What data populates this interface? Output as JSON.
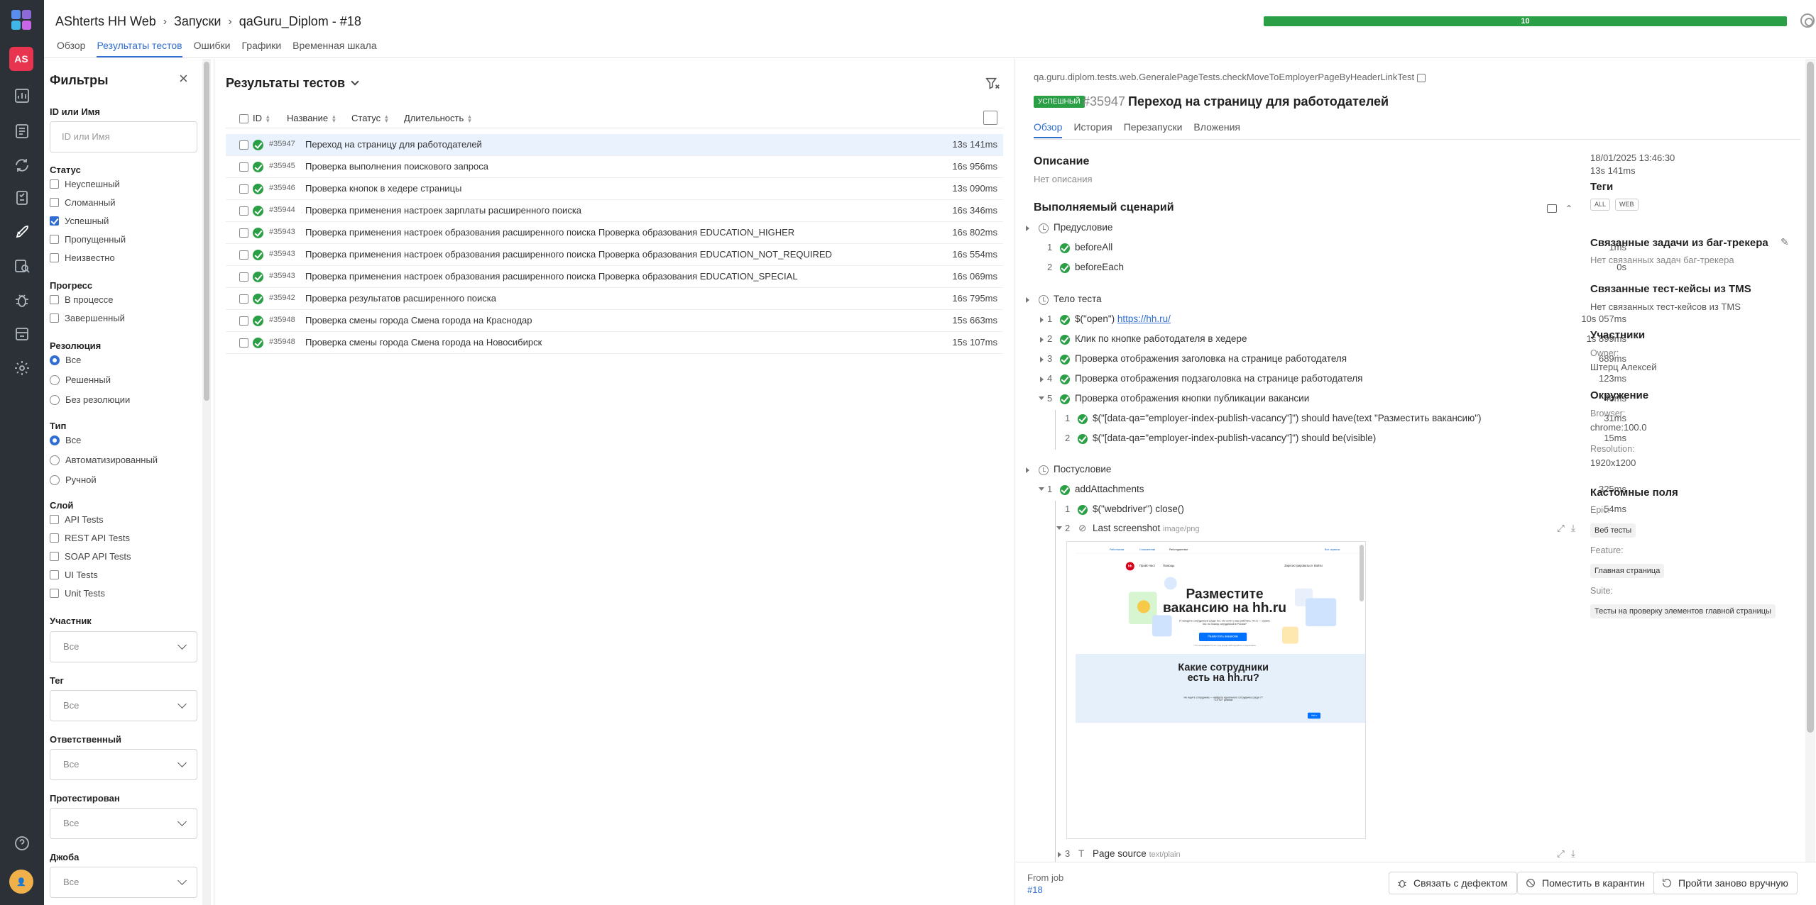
{
  "header": {
    "breadcrumb": [
      "AShterts HH Web",
      "Запуски",
      "qaGuru_Diplom - #18"
    ],
    "progress_label": "10",
    "progress_color": "#2b9f46",
    "accent_color": "#2f6dd0",
    "tabs": [
      "Обзор",
      "Результаты тестов",
      "Ошибки",
      "Графики",
      "Временная шкала"
    ],
    "active_tab": "Результаты тестов"
  },
  "rail": {
    "avatar": "AS",
    "user_avatar": "👤",
    "icons": [
      "allure-logo-icon",
      "dashboard-icon",
      "testcases-icon",
      "launches-icon",
      "jobs-icon",
      "rocket-icon",
      "search-results-icon",
      "bug-icon",
      "storage-icon",
      "settings-icon",
      "help-icon"
    ]
  },
  "filters": {
    "title": "Фильтры",
    "id_label": "ID или Имя",
    "id_placeholder": "ID или Имя",
    "status_label": "Статус",
    "status_options": [
      {
        "label": "Неуспешный",
        "checked": false
      },
      {
        "label": "Сломанный",
        "checked": false
      },
      {
        "label": "Успешный",
        "checked": true
      },
      {
        "label": "Пропущенный",
        "checked": false
      },
      {
        "label": "Неизвестно",
        "checked": false
      }
    ],
    "progress_label": "Прогресс",
    "progress_options": [
      "В процессе",
      "Завершенный"
    ],
    "resolution_label": "Резолюция",
    "resolution_options": [
      "Все",
      "Решенный",
      "Без резолюции"
    ],
    "type_label": "Тип",
    "type_options": [
      "Все",
      "Автоматизированный",
      "Ручной"
    ],
    "layer_label": "Слой",
    "layer_options": [
      "API Tests",
      "REST API Tests",
      "SOAP API Tests",
      "UI Tests",
      "Unit Tests"
    ],
    "member_label": "Участник",
    "tag_label": "Тег",
    "owner_label": "Ответственный",
    "tested_label": "Протестирован",
    "job_label": "Джоба",
    "select_value": "Все"
  },
  "results": {
    "title": "Результаты тестов",
    "columns": [
      "ID",
      "Название",
      "Статус",
      "Длительность"
    ],
    "rows": [
      {
        "id": "#35947",
        "name": "Переход на страницу для работодателей",
        "duration": "13s 141ms"
      },
      {
        "id": "#35945",
        "name": "Проверка выполнения поискового запроса",
        "duration": "16s 956ms"
      },
      {
        "id": "#35946",
        "name": "Проверка кнопок в хедере страницы",
        "duration": "13s 090ms"
      },
      {
        "id": "#35944",
        "name": "Проверка применения настроек зарплаты расширенного поиска",
        "duration": "16s 346ms"
      },
      {
        "id": "#35943",
        "name": "Проверка применения настроек образования расширенного поиска Проверка образования EDUCATION_HIGHER",
        "duration": "16s 802ms"
      },
      {
        "id": "#35943",
        "name": "Проверка применения настроек образования расширенного поиска Проверка образования EDUCATION_NOT_REQUIRED",
        "duration": "16s 554ms"
      },
      {
        "id": "#35943",
        "name": "Проверка применения настроек образования расширенного поиска Проверка образования EDUCATION_SPECIAL",
        "duration": "16s 069ms"
      },
      {
        "id": "#35942",
        "name": "Проверка результатов расширенного поиска",
        "duration": "16s 795ms"
      },
      {
        "id": "#35948",
        "name": "Проверка смены города Смена города на Краснодар",
        "duration": "15s 663ms"
      },
      {
        "id": "#35948",
        "name": "Проверка смены города Смена города на Новосибирск",
        "duration": "15s 107ms"
      }
    ]
  },
  "details": {
    "path": "qa.guru.diplom.tests.web.GeneralePageTests.checkMoveToEmployerPageByHeaderLinkTest",
    "status_badge": "УСПЕШНЫЙ",
    "id": "#35947",
    "name": "Переход на страницу для работодателей",
    "tabs": [
      "Обзор",
      "История",
      "Перезапуски",
      "Вложения"
    ],
    "description_title": "Описание",
    "description": "Нет описания",
    "scenario_title": "Выполняемый сценарий",
    "precondition": "Предусловие",
    "pre_steps": [
      {
        "n": "1",
        "label": "beforeAll",
        "dur": "1ms"
      },
      {
        "n": "2",
        "label": "beforeEach",
        "dur": "0s"
      }
    ],
    "body": "Тело теста",
    "body_steps": [
      {
        "n": "1",
        "label_prefix": "$(\"open\") ",
        "link": "https://hh.ru/",
        "dur": "10s 057ms"
      },
      {
        "n": "2",
        "label": "Клик по кнопке работодателя в хедере",
        "dur": "1s 899ms"
      },
      {
        "n": "3",
        "label": "Проверка отображения заголовка на странице работодателя",
        "dur": "689ms"
      },
      {
        "n": "4",
        "label": "Проверка отображения подзаголовка на странице работодателя",
        "dur": "123ms"
      },
      {
        "n": "5",
        "label": "Проверка отображения кнопки публикации вакансии",
        "dur": "46ms"
      }
    ],
    "sub_steps": [
      {
        "n": "1",
        "label": "$(\"[data-qa=\"employer-index-publish-vacancy\"]\") should have(text \"Разместить вакансию\")",
        "dur": "31ms"
      },
      {
        "n": "2",
        "label": "$(\"[data-qa=\"employer-index-publish-vacancy\"]\") should be(visible)",
        "dur": "15ms"
      }
    ],
    "postcondition": "Постусловие",
    "post_step": {
      "n": "1",
      "label": "addAttachments",
      "dur": "325ms"
    },
    "post_sub": {
      "n": "1",
      "label": "$(\"webdriver\") close()",
      "dur": "54ms"
    },
    "attach1": {
      "n": "2",
      "label": "Last screenshot",
      "type": "image/png"
    },
    "attach2": {
      "n": "3",
      "label": "Page source",
      "type": "text/plain"
    }
  },
  "screenshot": {
    "nav": [
      "Работникам",
      "Соискателям",
      "Работодателям",
      "Все сервисы"
    ],
    "menu": [
      "Прайс-лист",
      "Помощь",
      "Зарегистрироваться",
      "Войти"
    ],
    "logo": "hh",
    "headline": "Разместите вакансию на hh.ru",
    "sub": "И находите сотрудников среди тех, кто хочет у вас работать. hh.ru — сервис №1 по поиску сотрудников в России*",
    "button": "Разместить вакансию",
    "note": "* По посещаемости за 1 год среди сайтов работы и персонала",
    "headline2": "Какие сотрудники есть на hh.ru?",
    "sub2": "Не ищите сотрудника — найдите идеального сотрудника среди 77 714 927 резюме",
    "button2": "Найти"
  },
  "side": {
    "date": "18/01/2025 13:46:30",
    "duration": "13s 141ms",
    "tags_title": "Теги",
    "tags": [
      "ALL",
      "WEB"
    ],
    "issues_title": "Связанные задачи из баг-трекера",
    "issues_empty": "Нет связанных задач баг-трекера",
    "tms_title": "Связанные тест-кейсы из TMS",
    "tms_empty": "Нет связанных тест-кейсов из TMS",
    "members_title": "Участники",
    "owner_key": "Owner:",
    "owner_val": "Штерц Алексей",
    "env_title": "Окружение",
    "browser_key": "Browser:",
    "browser_val": "chrome:100.0",
    "resolution_key": "Resolution:",
    "resolution_val": "1920x1200",
    "custom_title": "Кастомные поля",
    "epic_key": "Epic:",
    "epic_val": "Веб тесты",
    "feature_key": "Feature:",
    "feature_val": "Главная страница",
    "suite_key": "Suite:",
    "suite_val": "Тесты на проверку элементов главной страницы"
  },
  "footer": {
    "from": "From job",
    "job": "#18",
    "btn_link": "Связать с дефектом",
    "btn_quarantine": "Поместить в карантин",
    "btn_rerun": "Пройти заново вручную"
  }
}
